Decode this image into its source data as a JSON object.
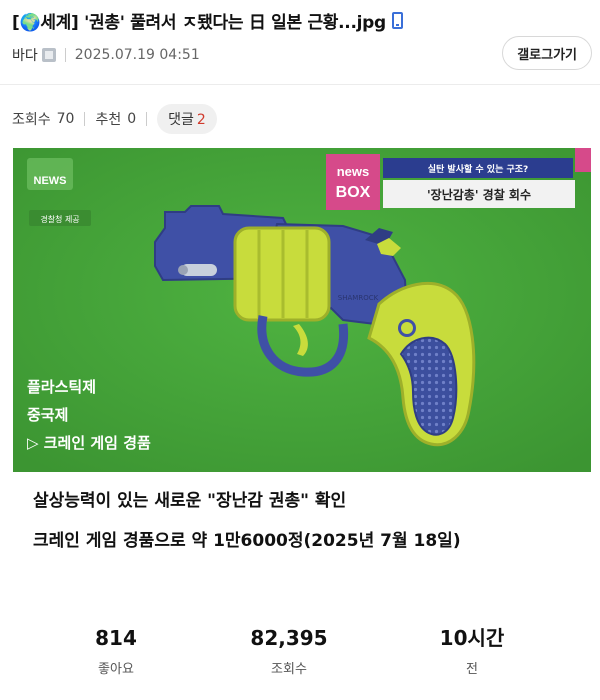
{
  "header": {
    "title": "[🌍세계] '권총' 풀려서 ㅈ됐다는 日 일본 근황...jpg",
    "author": "바다",
    "date": "2025.07.19 04:51",
    "gallery_button": "갤로그가기"
  },
  "stats": {
    "views_label": "조회수",
    "views": "70",
    "recommend_label": "추천",
    "recommend": "0",
    "comments_label": "댓글",
    "comments": "2"
  },
  "image": {
    "channel_logo": "NEWS",
    "credit": "경찰청 제공",
    "badge_top": "news",
    "badge_bottom": "BOX",
    "headline_small": "실탄 발사할 수 있는 구조?",
    "headline_main": "'장난감총' 경찰 회수",
    "gun_mark": "SHAMROCK",
    "overlay_lines": [
      "플라스틱제",
      "중국제",
      "▷ 크레인 게임 경품"
    ]
  },
  "captions": {
    "line1": "살상능력이 있는 새로운 \"장난감 권총\" 확인",
    "line2": "크레인 게임 경품으로 약 1만6000정(2025년 7월 18일)"
  },
  "footer": {
    "likes": "814",
    "likes_label": "좋아요",
    "views": "82,395",
    "views_label": "조회수",
    "time": "10시간",
    "time_label": "전"
  },
  "colors": {
    "comment_count": "#d03a2c",
    "photo_bg": "#46a53a",
    "gun_body": "#3f50a6",
    "gun_cylinder": "#c8dc3c",
    "newsbox_accent": "#d64a8a"
  }
}
